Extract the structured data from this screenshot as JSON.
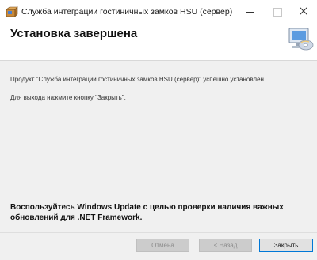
{
  "window": {
    "title": "Служба интеграции гостиничных замков HSU (сервер)",
    "app_icon": "installer-box-icon",
    "controls": {
      "minimize_icon": "minimize-icon",
      "maximize_icon": "maximize-icon",
      "close_icon": "close-icon"
    }
  },
  "header": {
    "title": "Установка завершена",
    "icon": "setup-computer-disc-icon"
  },
  "content": {
    "message_line1": "Продукт \"Служба интеграции гостиничных замков HSU (сервер)\" успешно установлен.",
    "message_line2": "Для выхода нажмите кнопку \"Закрыть\".",
    "update_notice": "Воспользуйтесь Windows Update с целью проверки наличия важных обновлений для .NET Framework."
  },
  "footer": {
    "cancel_label": "Отмена",
    "back_label": "< Назад",
    "close_label": "Закрыть"
  },
  "colors": {
    "content_bg": "#f0f0f0",
    "accent_border": "#0078d7",
    "disabled_button": "#cccccc"
  }
}
